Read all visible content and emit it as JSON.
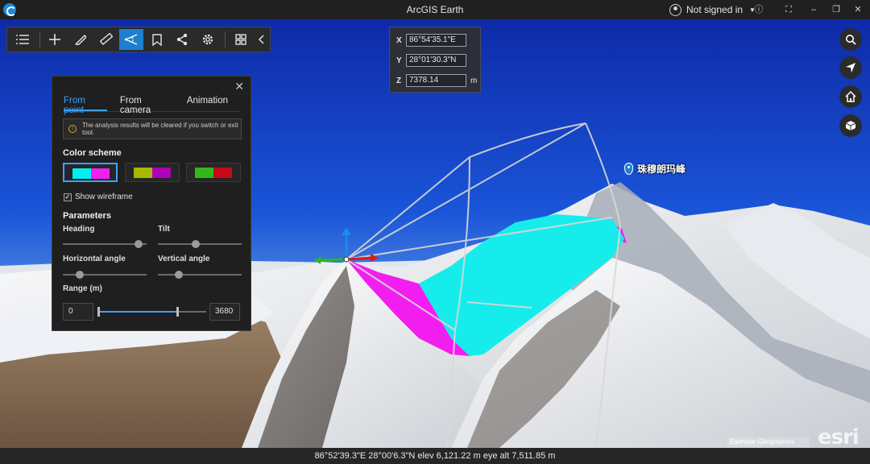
{
  "app": {
    "title": "ArcGIS Earth",
    "user_label": "Not signed in"
  },
  "coords": {
    "x_label": "X",
    "x_value": "86°54'35.1\"E",
    "y_label": "Y",
    "y_value": "28°01'30.3\"N",
    "z_label": "Z",
    "z_value": "7378.14",
    "z_unit": "m"
  },
  "status": {
    "text": "86°52'39.3\"E 28°00'6.3\"N  elev 6,121.22 m  eye alt 7,511.85 m"
  },
  "toolbar": {
    "tools": [
      "list-icon",
      "add-icon",
      "sketch-icon",
      "measure-icon",
      "viewshed-icon",
      "bookmark-icon",
      "share-icon",
      "settings-icon",
      "grid-icon",
      "chevron-left-icon"
    ],
    "active": "viewshed-icon"
  },
  "right_buttons": [
    "search-icon",
    "navigate-icon",
    "home-icon",
    "3d-cube-icon"
  ],
  "panel": {
    "tabs": [
      "From point",
      "From camera",
      "Animation"
    ],
    "active_tab": "From point",
    "warning": "The analysis results will be cleared if you switch or exit tool.",
    "color_scheme_label": "Color scheme",
    "color_schemes": [
      {
        "visible": "#00f0f0",
        "hidden": "#f020f0"
      },
      {
        "visible": "#a8b800",
        "hidden": "#b000b8"
      },
      {
        "visible": "#30b818",
        "hidden": "#c80818"
      }
    ],
    "selected_scheme": 0,
    "show_wireframe_label": "Show wireframe",
    "show_wireframe": true,
    "parameters_label": "Parameters",
    "heading_label": "Heading",
    "heading_value_frac": 0.9,
    "tilt_label": "Tilt",
    "tilt_value_frac": 0.45,
    "hangle_label": "Horizontal angle",
    "hangle_value_frac": 0.2,
    "vangle_label": "Vertical angle",
    "vangle_value_frac": 0.25,
    "range_label": "Range (m)",
    "range_min": "0",
    "range_max": "3680",
    "range_fill_frac": 0.73
  },
  "placemark": {
    "label": "珠穆朗玛峰"
  },
  "attribution": "Earthstar Geographics",
  "logo_text": "esri"
}
